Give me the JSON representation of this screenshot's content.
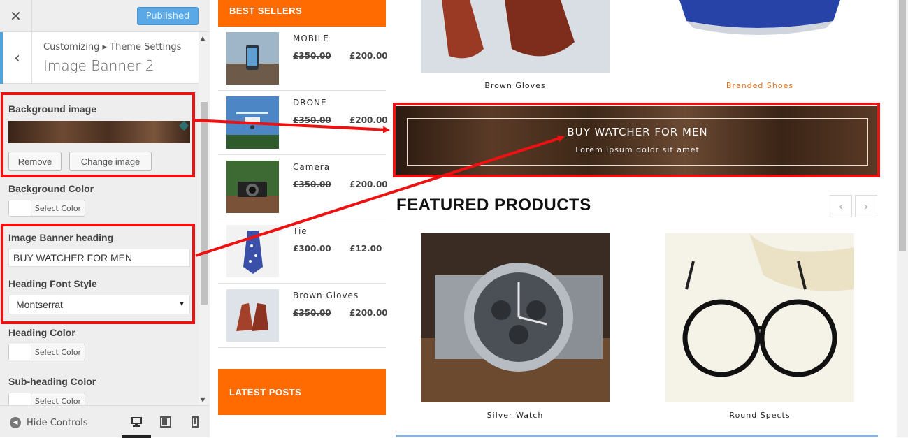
{
  "sidebar": {
    "close_icon": "close-icon",
    "publish_label": "Published",
    "breadcrumb": "Customizing ▸ Theme Settings",
    "section_title": "Image Banner 2",
    "controls": {
      "background_image_label": "Background image",
      "remove_label": "Remove",
      "change_image_label": "Change image",
      "background_color_label": "Background Color",
      "select_color_label": "Select Color",
      "heading_label": "Image Banner heading",
      "heading_value": "BUY WATCHER FOR MEN",
      "font_style_label": "Heading Font Style",
      "font_style_value": "Montserrat",
      "heading_color_label": "Heading Color",
      "subheading_color_label": "Sub-heading Color"
    },
    "footer": {
      "hide_controls_label": "Hide Controls"
    }
  },
  "preview": {
    "best_sellers_title": "BEST SELLERS",
    "latest_posts_title": "LATEST POSTS",
    "best_sellers": [
      {
        "name": "MOBILE",
        "old_price": "£350.00",
        "new_price": "£200.00"
      },
      {
        "name": "DRONE",
        "old_price": "£350.00",
        "new_price": "£200.00"
      },
      {
        "name": "Camera",
        "old_price": "£350.00",
        "new_price": "£200.00"
      },
      {
        "name": "Tie",
        "old_price": "£300.00",
        "new_price": "£12.00"
      },
      {
        "name": "Brown Gloves",
        "old_price": "£350.00",
        "new_price": "£200.00"
      }
    ],
    "top_products": [
      {
        "name": "Brown Gloves"
      },
      {
        "name": "Branded Shoes"
      }
    ],
    "banner": {
      "heading": "BUY WATCHER FOR MEN",
      "subheading": "Lorem ipsum dolor sit amet"
    },
    "featured_title": "FEATURED PRODUCTS",
    "featured_products": [
      {
        "name": "Silver Watch"
      },
      {
        "name": "Round Spects"
      }
    ]
  },
  "colors": {
    "accent_orange": "#ff6b00",
    "annotation_red": "#ee1111",
    "publish_blue": "#5aa9e6",
    "link_orange": "#e8731a"
  }
}
